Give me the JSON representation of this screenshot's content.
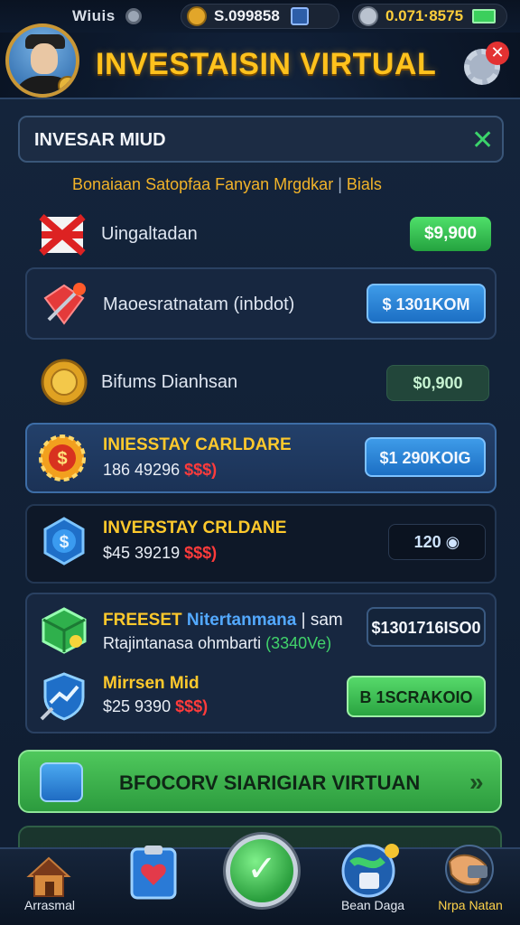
{
  "status_bar": {
    "left_text": "Wiuis",
    "currency_1": {
      "icon": "coin-bag-icon",
      "value": "S.099858"
    },
    "currency_2": {
      "icon": "shield-coin-icon",
      "value": "0.071·8575"
    }
  },
  "header": {
    "title": "INVESTAISIN VIRTUAL",
    "settings_badge": "✕"
  },
  "search": {
    "label": "INVESAR MIUD",
    "close": "✕"
  },
  "subtitle": {
    "main": "Bonaiaan Satopfaa Fanyan Mrgdkar",
    "sep": "|",
    "secondary": "Bials"
  },
  "rows": [
    {
      "id": "r1",
      "icon": "flag-icon",
      "text": "Uingaltadan",
      "button": "$9,900"
    },
    {
      "id": "r2",
      "icon": "alert-shield-icon",
      "text": "Maoesratnatam (inbdot)",
      "button": "$ 1301KOM"
    },
    {
      "id": "r3",
      "icon": "gold-coin-icon",
      "text": "Bifums Dianhsan",
      "button": "$0,900"
    },
    {
      "id": "r4",
      "icon": "dollar-gear-icon",
      "title": "INIESSTAY CARLDARE",
      "sub": "186 49296",
      "sub_red": "$$$)",
      "button": "$1 290KOIG"
    },
    {
      "id": "r5",
      "icon": "dollar-badge-icon",
      "title": "INVERSTAY CRLDANE",
      "sub": "$45 39219",
      "sub_red": "$$$)",
      "button": "120",
      "button_icon": "◉"
    },
    {
      "id": "r6",
      "icon": "cube-icon",
      "title": "FREESET",
      "title_blue": "Nitertanmana",
      "title_tail": "| sam",
      "sub": "Rtajintanasa ohmbarti",
      "sub_green": "(3340Ve)",
      "button": "$1301716ISO0"
    },
    {
      "id": "r7",
      "icon": "chart-shield-icon",
      "title": "Mirrsen Mid",
      "sub": "$25 9390",
      "sub_red": "$$$)",
      "button": "B 1SCRAKOIO"
    }
  ],
  "cta": {
    "label": "BFOCORV SIARIGIAR VIRTUAN",
    "arrow": "»"
  },
  "nav": {
    "items": [
      {
        "label": "Arrasmal",
        "icon": "home-icon"
      },
      {
        "label": "",
        "icon": "clipboard-heart-icon"
      },
      {
        "label": "",
        "icon": "check-icon"
      },
      {
        "label": "Bean Daga",
        "icon": "globe-bag-icon"
      },
      {
        "label": "Nrpa Natan",
        "icon": "wallet-hand-icon"
      }
    ],
    "center_glyph": "✓"
  },
  "colors": {
    "accent_gold": "#ffc21d",
    "accent_green": "#41d36b",
    "accent_blue": "#3e9be8",
    "background": "#0d1a2e"
  }
}
